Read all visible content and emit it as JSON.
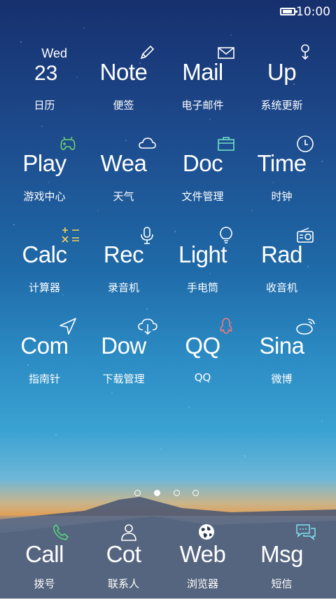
{
  "status": {
    "time": "10:00"
  },
  "calendar": {
    "weekday": "Wed",
    "day": "23",
    "label": "日历"
  },
  "grid": [
    {
      "abbr": "Note",
      "label": "便签"
    },
    {
      "abbr": "Mail",
      "label": "电子邮件"
    },
    {
      "abbr": "Up",
      "label": "系统更新"
    },
    {
      "abbr": "Play",
      "label": "游戏中心"
    },
    {
      "abbr": "Wea",
      "label": "天气"
    },
    {
      "abbr": "Doc",
      "label": "文件管理"
    },
    {
      "abbr": "Time",
      "label": "时钟"
    },
    {
      "abbr": "Calc",
      "label": "计算器"
    },
    {
      "abbr": "Rec",
      "label": "录音机"
    },
    {
      "abbr": "Light",
      "label": "手电筒"
    },
    {
      "abbr": "Rad",
      "label": "收音机"
    },
    {
      "abbr": "Com",
      "label": "指南针"
    },
    {
      "abbr": "Dow",
      "label": "下载管理"
    },
    {
      "abbr": "QQ",
      "label": "QQ"
    },
    {
      "abbr": "Sina",
      "label": "微博"
    }
  ],
  "pager": {
    "pages": 4,
    "active": 2
  },
  "dock": [
    {
      "abbr": "Call",
      "label": "拨号"
    },
    {
      "abbr": "Cot",
      "label": "联系人"
    },
    {
      "abbr": "Web",
      "label": "浏览器"
    },
    {
      "abbr": "Msg",
      "label": "短信"
    }
  ],
  "icons": [
    "pencil-icon",
    "mail-icon",
    "update-icon",
    "gamepad-icon",
    "cloud-icon",
    "folder-icon",
    "clock-icon",
    "calculator-icon",
    "microphone-icon",
    "lightbulb-icon",
    "radio-icon",
    "compass-icon",
    "cloud-download-icon",
    "qq-icon",
    "weibo-icon",
    "phone-icon",
    "contact-icon",
    "globe-icon",
    "message-icon"
  ],
  "colors": {
    "gamepad": "#6fd36f",
    "folder": "#6fe0c8",
    "calculator": "#f1d35a",
    "qq": "#f07c76",
    "phone": "#55d47a",
    "message": "#7ee0f0"
  }
}
